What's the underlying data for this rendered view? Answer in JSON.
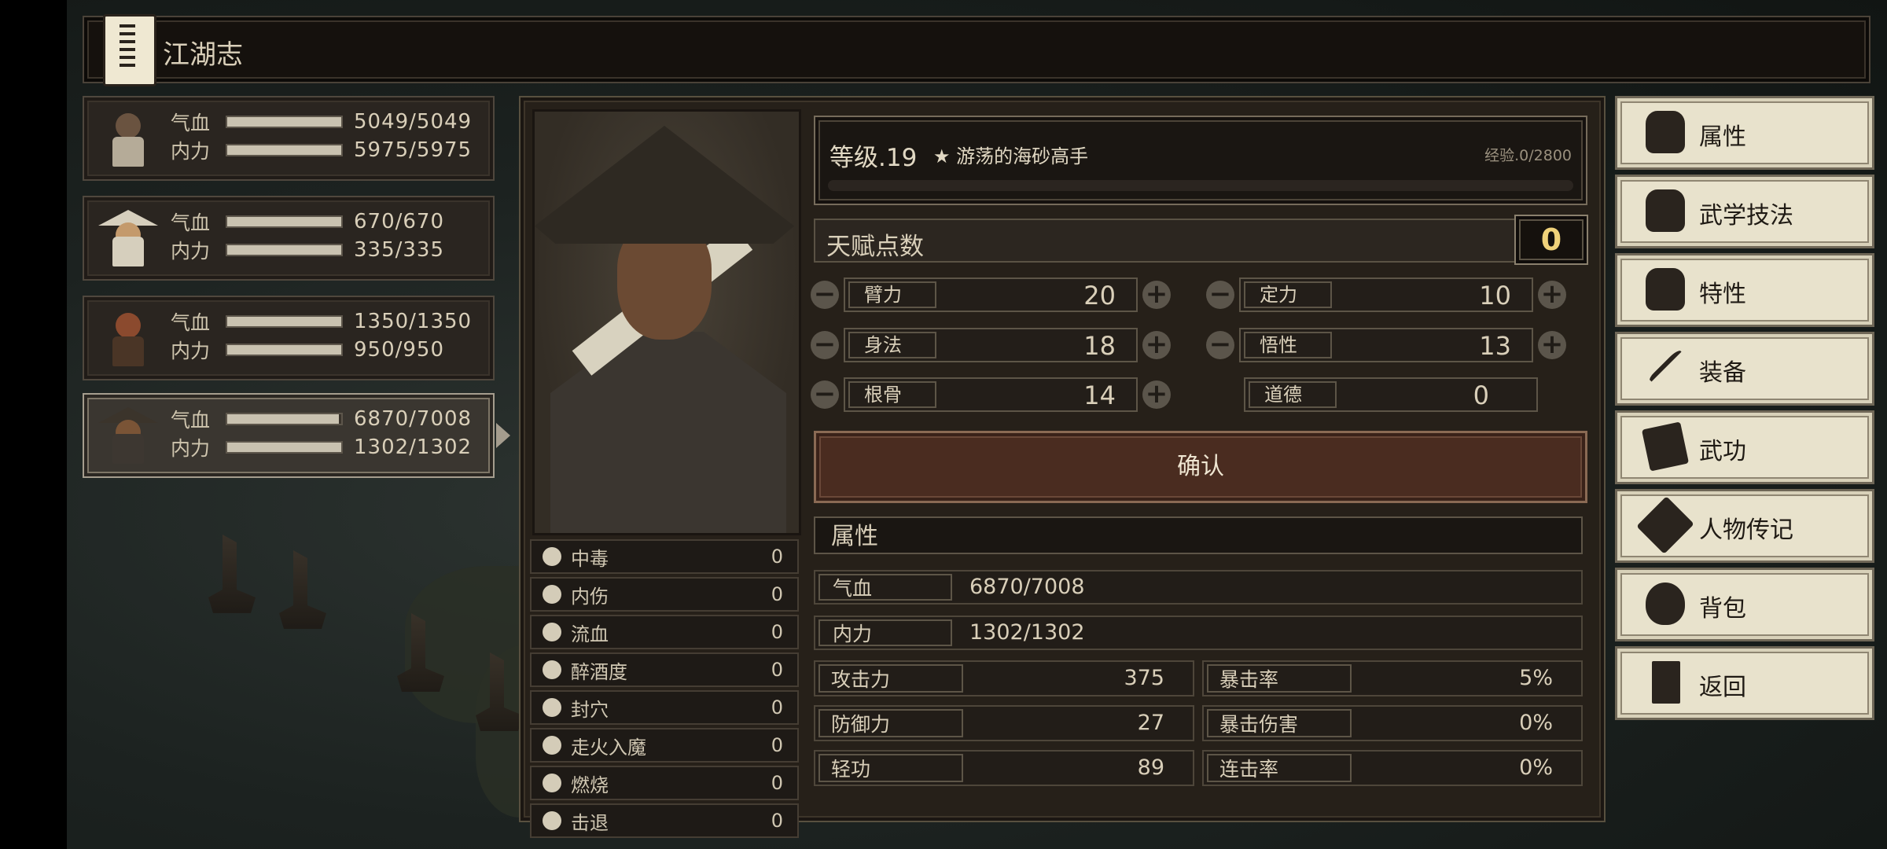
{
  "header": {
    "title": "江湖志"
  },
  "party": [
    {
      "hp_label": "气血",
      "hp": "5049/5049",
      "hp_frac": 1.0,
      "mp_label": "内力",
      "mp": "5975/5975",
      "mp_frac": 1.0
    },
    {
      "hp_label": "气血",
      "hp": "670/670",
      "hp_frac": 1.0,
      "mp_label": "内力",
      "mp": "335/335",
      "mp_frac": 1.0
    },
    {
      "hp_label": "气血",
      "hp": "1350/1350",
      "hp_frac": 1.0,
      "mp_label": "内力",
      "mp": "950/950",
      "mp_frac": 1.0
    },
    {
      "hp_label": "气血",
      "hp": "6870/7008",
      "hp_frac": 0.98,
      "mp_label": "内力",
      "mp": "1302/1302",
      "mp_frac": 1.0
    }
  ],
  "status_effects": [
    {
      "name": "中毒",
      "value": "0",
      "icon": "skull-icon"
    },
    {
      "name": "内伤",
      "value": "0",
      "icon": "broken-heart-icon"
    },
    {
      "name": "流血",
      "value": "0",
      "icon": "blood-drop-icon"
    },
    {
      "name": "醉酒度",
      "value": "0",
      "icon": "drunk-face-icon"
    },
    {
      "name": "封穴",
      "value": "0",
      "icon": "acupoint-icon"
    },
    {
      "name": "走火入魔",
      "value": "0",
      "icon": "demon-face-icon"
    },
    {
      "name": "燃烧",
      "value": "0",
      "icon": "flame-icon"
    },
    {
      "name": "击退",
      "value": "0",
      "icon": "boot-icon"
    }
  ],
  "level": {
    "label": "等级.19",
    "title": "★ 游荡的海砂高手",
    "exp": "经验.0/2800",
    "exp_frac": 0
  },
  "talent": {
    "label": "天赋点数",
    "value": "0"
  },
  "attributes": {
    "biceps": {
      "label": "臂力",
      "value": "20"
    },
    "focus": {
      "label": "定力",
      "value": "10"
    },
    "agility": {
      "label": "身法",
      "value": "18"
    },
    "insight": {
      "label": "悟性",
      "value": "13"
    },
    "constitution": {
      "label": "根骨",
      "value": "14"
    },
    "morality": {
      "label": "道德",
      "value": "0"
    }
  },
  "confirm_label": "确认",
  "stats": {
    "header": "属性",
    "hp": {
      "label": "气血",
      "value": "6870/7008"
    },
    "mp": {
      "label": "内力",
      "value": "1302/1302"
    },
    "attack": {
      "label": "攻击力",
      "value": "375"
    },
    "crit": {
      "label": "暴击率",
      "value": "5%"
    },
    "defense": {
      "label": "防御力",
      "value": "27"
    },
    "critdmg": {
      "label": "暴击伤害",
      "value": "0%"
    },
    "qinggong": {
      "label": "轻功",
      "value": "89"
    },
    "combo": {
      "label": "连击率",
      "value": "0%"
    }
  },
  "menu": [
    {
      "label": "属性",
      "icon": "character-icon"
    },
    {
      "label": "武学技法",
      "icon": "skill-icon"
    },
    {
      "label": "特性",
      "icon": "trait-icon"
    },
    {
      "label": "装备",
      "icon": "sword-icon"
    },
    {
      "label": "武功",
      "icon": "book-icon"
    },
    {
      "label": "人物传记",
      "icon": "scroll-icon"
    },
    {
      "label": "背包",
      "icon": "bag-icon"
    },
    {
      "label": "返回",
      "icon": "door-icon"
    }
  ]
}
